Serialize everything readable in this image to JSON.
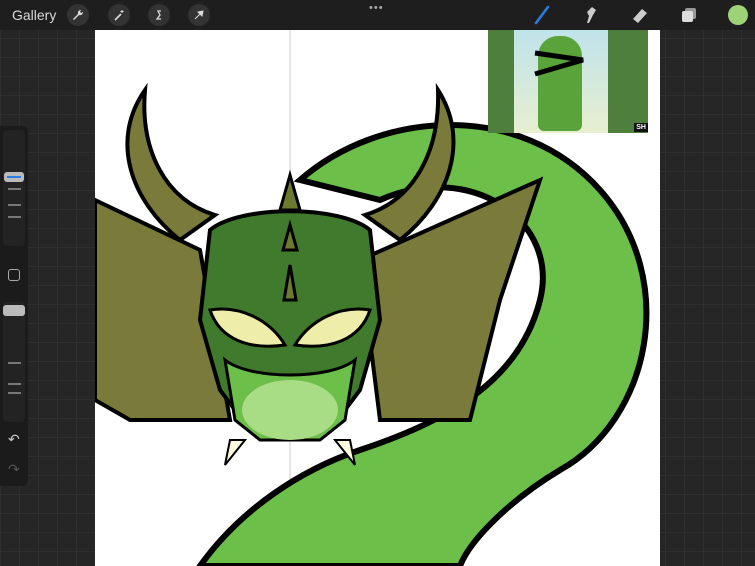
{
  "topbar": {
    "gallery_label": "Gallery",
    "more_label": "•••",
    "tools": [
      "wrench-icon",
      "magic-wand-icon",
      "selection-icon",
      "transform-arrow-icon"
    ],
    "right_tools": [
      "brush-icon",
      "smudge-icon",
      "eraser-icon",
      "layers-icon"
    ],
    "active_tool": "brush",
    "brush_color": "#2a7de1",
    "current_color": "#9ed277"
  },
  "reference": {
    "badge": "SH"
  },
  "sidebar": {
    "brush_size_indicator_color": "#2a7de1",
    "undo": "↶",
    "redo": "↷"
  }
}
